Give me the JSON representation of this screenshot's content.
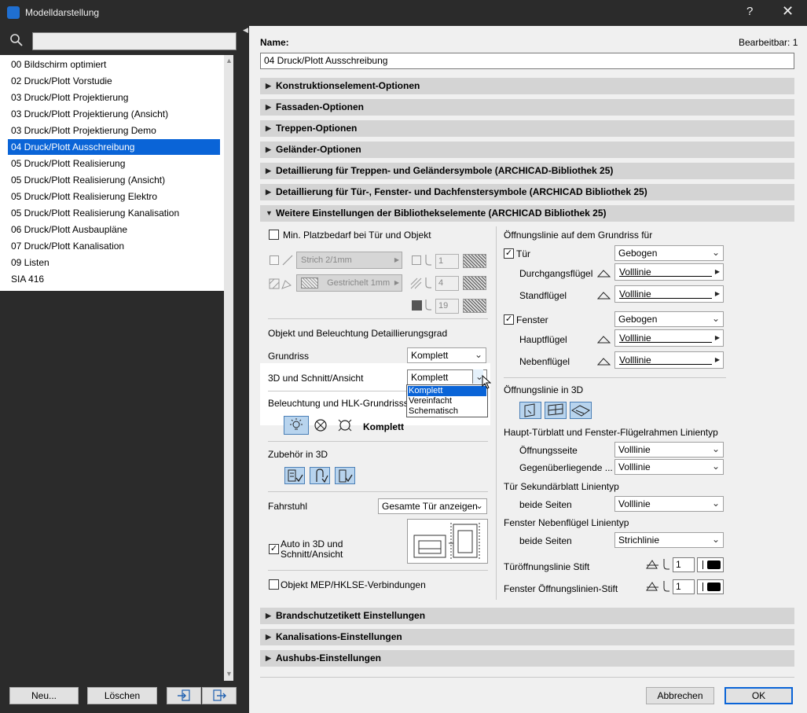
{
  "window": {
    "title": "Modelldarstellung",
    "help": "?",
    "close": "✕"
  },
  "left": {
    "search_placeholder": "",
    "items": [
      "00 Bildschirm optimiert",
      "02 Druck/Plott Vorstudie",
      "03 Druck/Plott Projektierung",
      "03 Druck/Plott Projektierung (Ansicht)",
      "03 Druck/Plott Projektierung Demo",
      "04 Druck/Plott Ausschreibung",
      "05 Druck/Plott Realisierung",
      "05 Druck/Plott Realisierung (Ansicht)",
      "05 Druck/Plott Realisierung Elektro",
      "05 Druck/Plott Realisierung Kanalisation",
      "06 Druck/Plott Ausbaupläne",
      "07 Druck/Plott Kanalisation",
      "09 Listen",
      "SIA 416"
    ],
    "selected_index": 5,
    "buttons": {
      "new": "Neu...",
      "delete": "Löschen"
    }
  },
  "right": {
    "name_label": "Name:",
    "editable_label": "Bearbeitbar: 1",
    "name_value": "04 Druck/Plott Ausschreibung",
    "sections_top": [
      "Konstruktionselement-Optionen",
      "Fassaden-Optionen",
      "Treppen-Optionen",
      "Geländer-Optionen",
      "Detaillierung für Treppen- und Geländersymbole (ARCHICAD-Bibliothek 25)",
      "Detaillierung für Tür-, Fenster- und Dachfenstersymbole (ARCHICAD Bibliothek 25)"
    ],
    "expanded_section": "Weitere Einstellungen der Bibliothekselemente (ARCHICAD Bibliothek 25)",
    "sections_bottom": [
      "Brandschutzetikett Einstellungen",
      "Kanalisations-Einstellungen",
      "Aushubs-Einstellungen"
    ],
    "left_col": {
      "min_space_label": "Min. Platzbedarf bei Tür und Objekt",
      "line_strich": "Strich 2/1mm",
      "line_gestrichelt": "Gestrichelt 1mm",
      "pen1": "1",
      "pen2": "4",
      "pen3": "19",
      "detail_heading": "Objekt und Beleuchtung Detaillierungsgrad",
      "grundriss_label": "Grundriss",
      "grundriss_value": "Komplett",
      "schnitt_label": "3D und Schnitt/Ansicht",
      "schnitt_value": "Komplett",
      "dropdown_options": [
        "Komplett",
        "Vereinfacht",
        "Schematisch"
      ],
      "beleuchtung_label": "Beleuchtung und HLK-Grundrisssym",
      "beleuchtung_value": "Komplett",
      "zubehoer_label": "Zubehör in 3D",
      "fahrstuhl_label": "Fahrstuhl",
      "fahrstuhl_value": "Gesamte Tür anzeigen",
      "auto_label_1": "Auto in 3D und",
      "auto_label_2": "Schnitt/Ansicht",
      "mep_label": "Objekt MEP/HKLSE-Verbindungen"
    },
    "right_col": {
      "oeffnung_heading": "Öffnungslinie auf dem Grundriss für",
      "tuer_label": "Tür",
      "tuer_value": "Gebogen",
      "durchgang_label": "Durchgangsflügel",
      "durchgang_value": "Volllinie",
      "stand_label": "Standflügel",
      "stand_value": "Volllinie",
      "fenster_label": "Fenster",
      "fenster_value": "Gebogen",
      "haupt_label": "Hauptflügel",
      "haupt_value": "Volllinie",
      "neben_label": "Nebenflügel",
      "neben_value": "Volllinie",
      "oeffnung3d_heading": "Öffnungslinie in 3D",
      "haupttuer_heading": "Haupt-Türblatt und Fenster-Flügelrahmen Linientyp",
      "oeffnungsseite_label": "Öffnungsseite",
      "oeffnungsseite_value": "Volllinie",
      "gegen_label": "Gegenüberliegende ...",
      "gegen_value": "Volllinie",
      "sekundaer_heading": "Tür Sekundärblatt Linientyp",
      "beide1_label": "beide Seiten",
      "beide1_value": "Volllinie",
      "nebenfl_heading": "Fenster Nebenflügel Linientyp",
      "beide2_label": "beide Seiten",
      "beide2_value": "Strichlinie",
      "tuerstift_label": "Türöffnungslinie Stift",
      "tuerstift_value": "1",
      "fensterstift_label": "Fenster Öffnungslinien-Stift",
      "fensterstift_value": "1"
    },
    "buttons": {
      "cancel": "Abbrechen",
      "ok": "OK"
    }
  }
}
